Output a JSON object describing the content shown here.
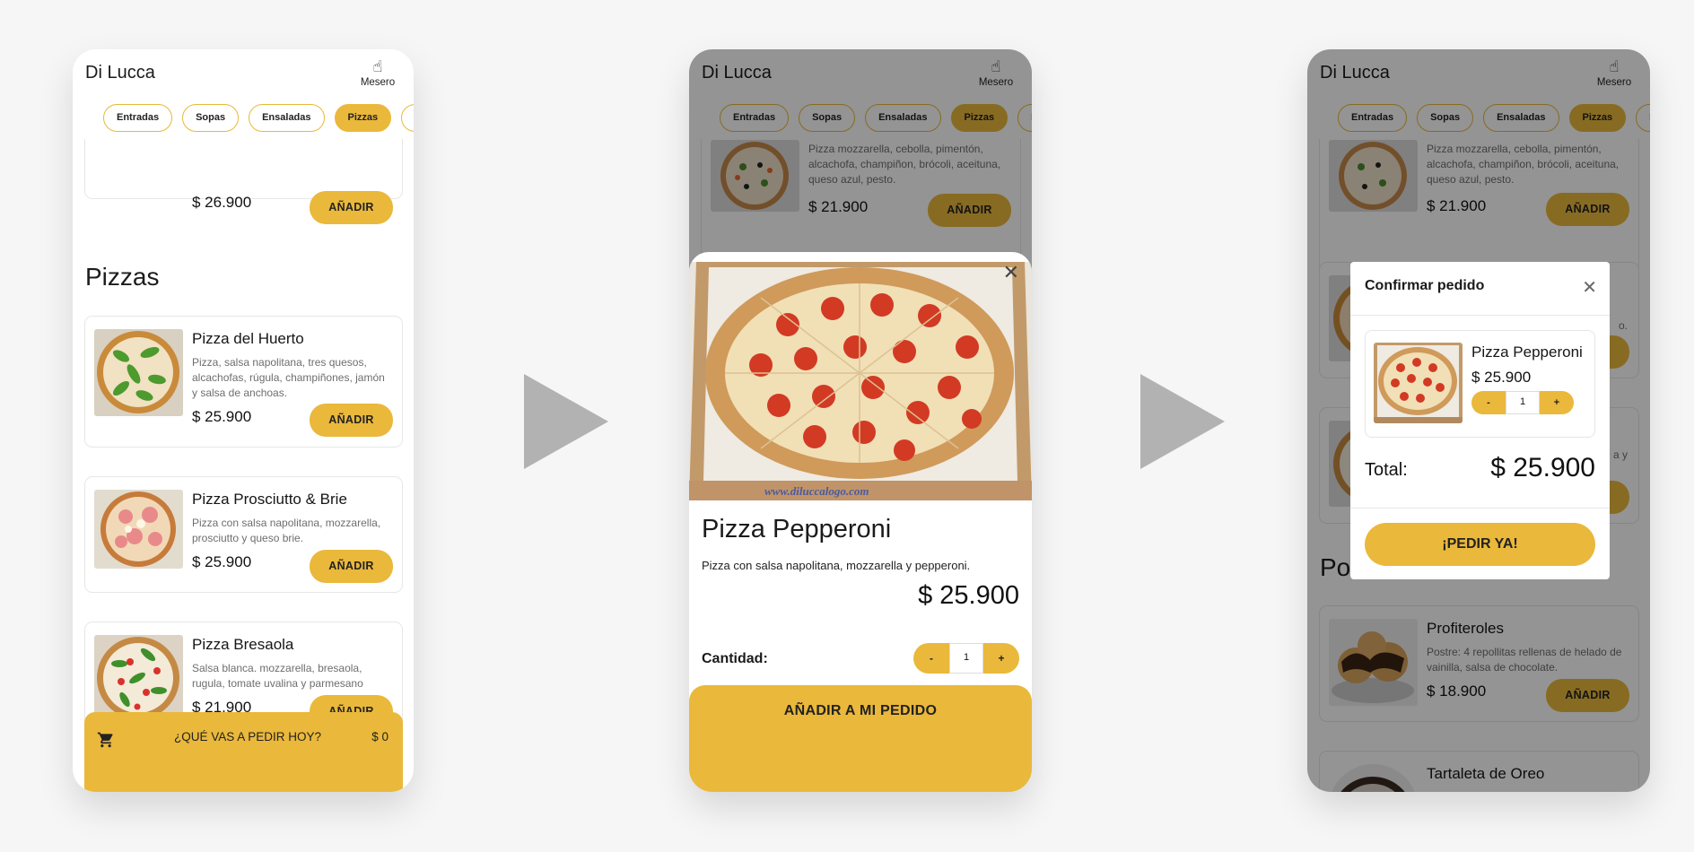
{
  "app": {
    "brand": "Di Lucca",
    "waiter_label": "Mesero",
    "waiter_icon": "☝"
  },
  "categories": [
    "Entradas",
    "Sopas",
    "Ensaladas",
    "Pizzas",
    "P"
  ],
  "screen1": {
    "partial_price": "$ 26.900",
    "section_title": "Pizzas",
    "items": [
      {
        "name": "Pizza del Huerto",
        "desc": "Pizza, salsa napolitana, tres quesos, alcachofas, rúgula, champiñones, jamón y salsa de anchoas.",
        "price": "$ 25.900"
      },
      {
        "name": "Pizza Prosciutto & Brie",
        "desc": "Pizza con salsa napolitana, mozzarella, prosciutto y queso brie.",
        "price": "$ 25.900"
      },
      {
        "name": "Pizza Bresaola",
        "desc": "Salsa blanca. mozzarella, bresaola, rugula, tomate uvalina y parmesano",
        "price": "$ 21.900"
      }
    ],
    "cart": {
      "prompt": "¿QUÉ VAS A PEDIR HOY?",
      "amount": "$ 0"
    }
  },
  "add_label": "AÑADIR",
  "bg_item": {
    "desc": "Pizza mozzarella, cebolla, pimentón, alcachofa, champiñon, brócoli, aceituna, queso azul, pesto.",
    "price": "$ 21.900"
  },
  "screen2": {
    "title": "Pizza Pepperoni",
    "desc": "Pizza con salsa napolitana, mozzarella y pepperoni.",
    "price": "$ 25.900",
    "qty_label": "Cantidad:",
    "qty": "1",
    "minus": "-",
    "plus": "+",
    "cta": "AÑADIR A MI PEDIDO",
    "watermark": "www.diluccalogo.com"
  },
  "screen3": {
    "dialog_title": "Confirmar pedido",
    "item_name": "Pizza Pepperoni",
    "item_price": "$ 25.900",
    "qty": "1",
    "total_label": "Total:",
    "total_value": "$ 25.900",
    "order_button": "¡PEDIR YA!",
    "bg_section": "Po",
    "bg_frag1": "o.",
    "bg_frag2": "a y",
    "bg_items": [
      {
        "name": "Profiteroles",
        "desc": "Postre: 4 repollitas rellenas de helado de vainilla, salsa de chocolate.",
        "price": "$ 18.900"
      },
      {
        "name": "Tartaleta de Oreo"
      }
    ]
  },
  "colors": {
    "accent": "#EAB83B",
    "page_bg": "#F6F6F6",
    "arrow": "#B2B2B2"
  }
}
